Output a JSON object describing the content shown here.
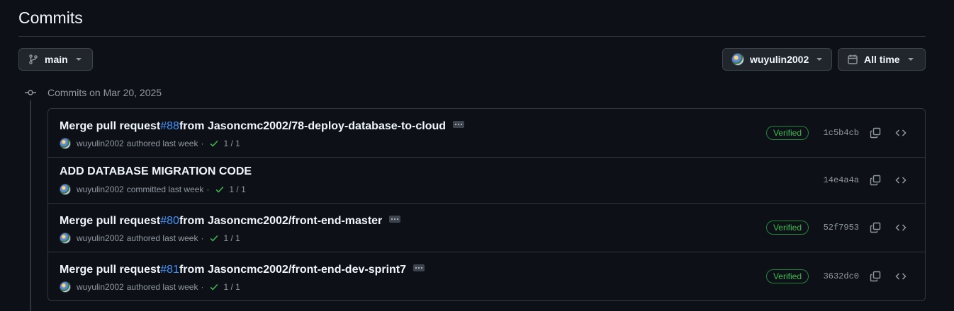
{
  "page": {
    "title": "Commits"
  },
  "filters": {
    "branch": "main",
    "author": "wuyulin2002",
    "time": "All time"
  },
  "group": {
    "label": "Commits on Mar 20, 2025"
  },
  "commits": [
    {
      "prefix": "Merge pull request ",
      "pr": "#88",
      "suffix": " from Jasoncmc2002/78-deploy-database-to-cloud",
      "author": "wuyulin2002",
      "action": "authored last week",
      "separator": "·",
      "checks": "1 / 1",
      "verified": "Verified",
      "sha": "1c5b4cb"
    },
    {
      "message": "ADD DATABASE MIGRATION CODE",
      "author": "wuyulin2002",
      "action": "committed last week",
      "separator": "·",
      "checks": "1 / 1",
      "sha": "14e4a4a"
    },
    {
      "prefix": "Merge pull request ",
      "pr": "#80",
      "suffix": " from Jasoncmc2002/front-end-master",
      "author": "wuyulin2002",
      "action": "authored last week",
      "separator": "·",
      "checks": "1 / 1",
      "verified": "Verified",
      "sha": "52f7953"
    },
    {
      "prefix": "Merge pull request ",
      "pr": "#81",
      "suffix": " from Jasoncmc2002/front-end-dev-sprint7",
      "author": "wuyulin2002",
      "action": "authored last week",
      "separator": "·",
      "checks": "1 / 1",
      "verified": "Verified",
      "sha": "3632dc0"
    }
  ],
  "colors": {
    "background": "#0d1117",
    "accent_link": "#4493f8",
    "verified": "#3fb950",
    "border": "#30363d"
  }
}
